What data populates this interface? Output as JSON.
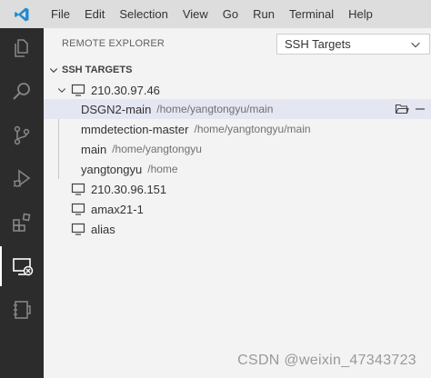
{
  "menu": {
    "items": [
      "File",
      "Edit",
      "Selection",
      "View",
      "Go",
      "Run",
      "Terminal",
      "Help"
    ]
  },
  "activity_bar": {
    "items": [
      {
        "icon": "files-icon"
      },
      {
        "icon": "search-icon"
      },
      {
        "icon": "source-control-icon"
      },
      {
        "icon": "run-debug-icon"
      },
      {
        "icon": "extensions-icon"
      },
      {
        "icon": "remote-explorer-icon",
        "active": true
      },
      {
        "icon": "notebook-icon"
      }
    ]
  },
  "sidebar": {
    "title": "REMOTE EXPLORER",
    "target_select": {
      "value": "SSH Targets"
    },
    "section": {
      "title": "SSH TARGETS"
    },
    "hosts": [
      {
        "name": "210.30.97.46",
        "expanded": true,
        "folders": [
          {
            "name": "DSGN2-main",
            "path": "/home/yangtongyu/main",
            "selected": true
          },
          {
            "name": "mmdetection-master",
            "path": "/home/yangtongyu/main"
          },
          {
            "name": "main",
            "path": "/home/yangtongyu"
          },
          {
            "name": "yangtongyu",
            "path": "/home"
          }
        ]
      },
      {
        "name": "210.30.96.151"
      },
      {
        "name": "amax21-1"
      },
      {
        "name": "alias"
      }
    ]
  },
  "watermark": "CSDN @weixin_47343723",
  "colors": {
    "activity_bar": "#2c2c2c",
    "sidebar": "#f3f3f3",
    "selection": "#e4e6f1",
    "vscode_blue": "#0078d4"
  }
}
